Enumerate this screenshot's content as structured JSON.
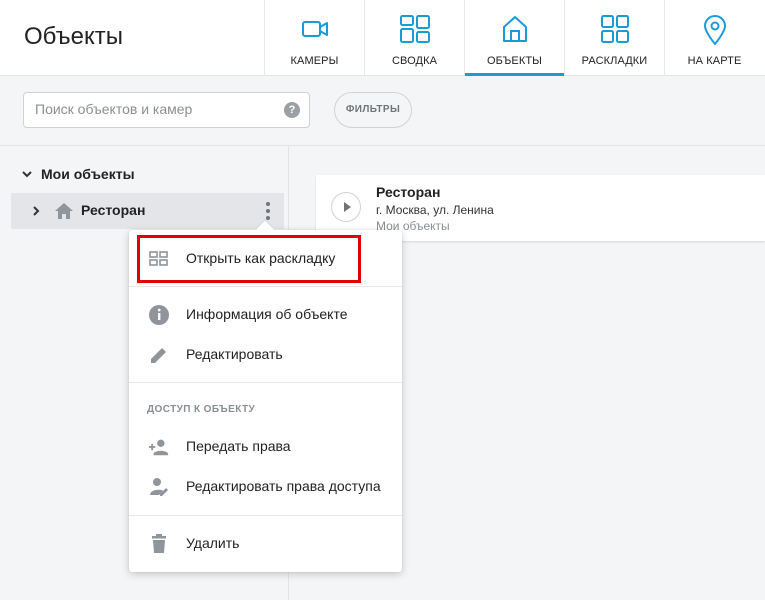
{
  "header": {
    "title": "Объекты",
    "tabs": [
      {
        "label": "КАМЕРЫ",
        "icon": "camera-icon",
        "active": false
      },
      {
        "label": "СВОДКА",
        "icon": "dashboard-icon",
        "active": false
      },
      {
        "label": "ОБЪЕКТЫ",
        "icon": "home-icon",
        "active": true
      },
      {
        "label": "РАСКЛАДКИ",
        "icon": "grid-icon",
        "active": false
      },
      {
        "label": "НА КАРТЕ",
        "icon": "map-pin-icon",
        "active": false
      }
    ],
    "accent_color": "#1a9bd7"
  },
  "toolbar": {
    "search_placeholder": "Поиск объектов и камер",
    "help_label": "?",
    "filters_label": "ФИЛЬТРЫ"
  },
  "tree": {
    "root_label": "Мои объекты",
    "item_label": "Ресторан"
  },
  "card": {
    "name": "Ресторан",
    "address": "г. Москва, ул. Ленина",
    "group": "Мои объекты"
  },
  "menu": {
    "open_as_layout": "Открыть как раскладку",
    "object_info": "Информация об объекте",
    "edit": "Редактировать",
    "access_section": "ДОСТУП К ОБЪЕКТУ",
    "transfer_rights": "Передать права",
    "edit_access": "Редактировать права доступа",
    "delete": "Удалить"
  },
  "highlight_color": "#e00000"
}
